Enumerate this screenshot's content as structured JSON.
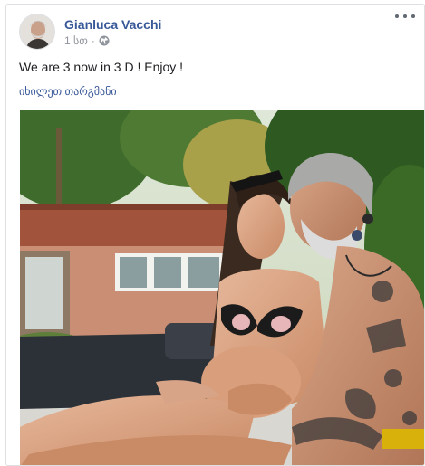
{
  "post": {
    "author": "Gianluca Vacchi",
    "timestamp": "1 სთ",
    "separator": "·",
    "privacy_icon": "globe-icon",
    "text": "We are 3 now in 3 D ! Enjoy !",
    "translate_link": "იხილეთ თარგმანი",
    "photo_icon": "post-photo"
  },
  "colors": {
    "link": "#385898",
    "meta": "#90949c",
    "text": "#1c1e21"
  }
}
